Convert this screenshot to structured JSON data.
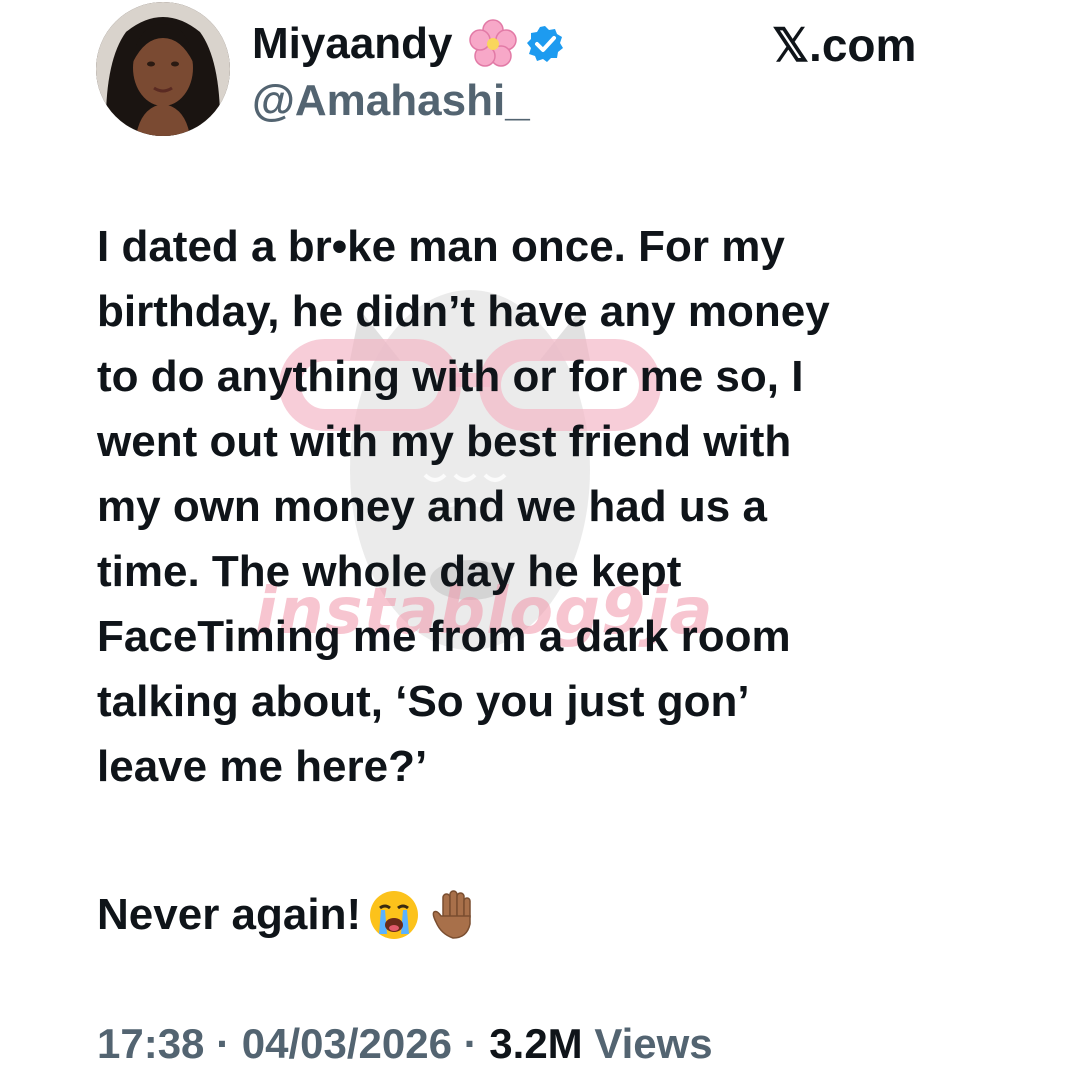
{
  "author": {
    "display_name": "Miyaandy",
    "handle": "@Amahashi_",
    "verified": true,
    "name_emoji": "cherry-blossom"
  },
  "site_label": "𝕏.com",
  "tweet": {
    "lines": [
      "I dated a br•ke man once. For my",
      "birthday, he didn’t have any money",
      "to do anything with or for me so, I",
      "went out with my best friend with",
      "my own money and we had us a",
      "time. The whole day he kept",
      "FaceTiming me from a dark room",
      "talking about, ‘So you just gon’",
      "leave me here?’"
    ],
    "closing": "Never again!",
    "closing_emojis": [
      "loudly-crying-face",
      "raised-hand-medium-dark-skin"
    ]
  },
  "meta": {
    "time": "17:38",
    "separator": " · ",
    "date": "04/03/2026",
    "views_count": "3.2M",
    "views_label": "Views"
  },
  "watermark": {
    "text": "instablog9ja"
  },
  "colors": {
    "primary_text": "#0f1419",
    "secondary_text": "#536471",
    "verified_blue": "#1d9bf0",
    "watermark_pink": "#f0a0b4"
  }
}
